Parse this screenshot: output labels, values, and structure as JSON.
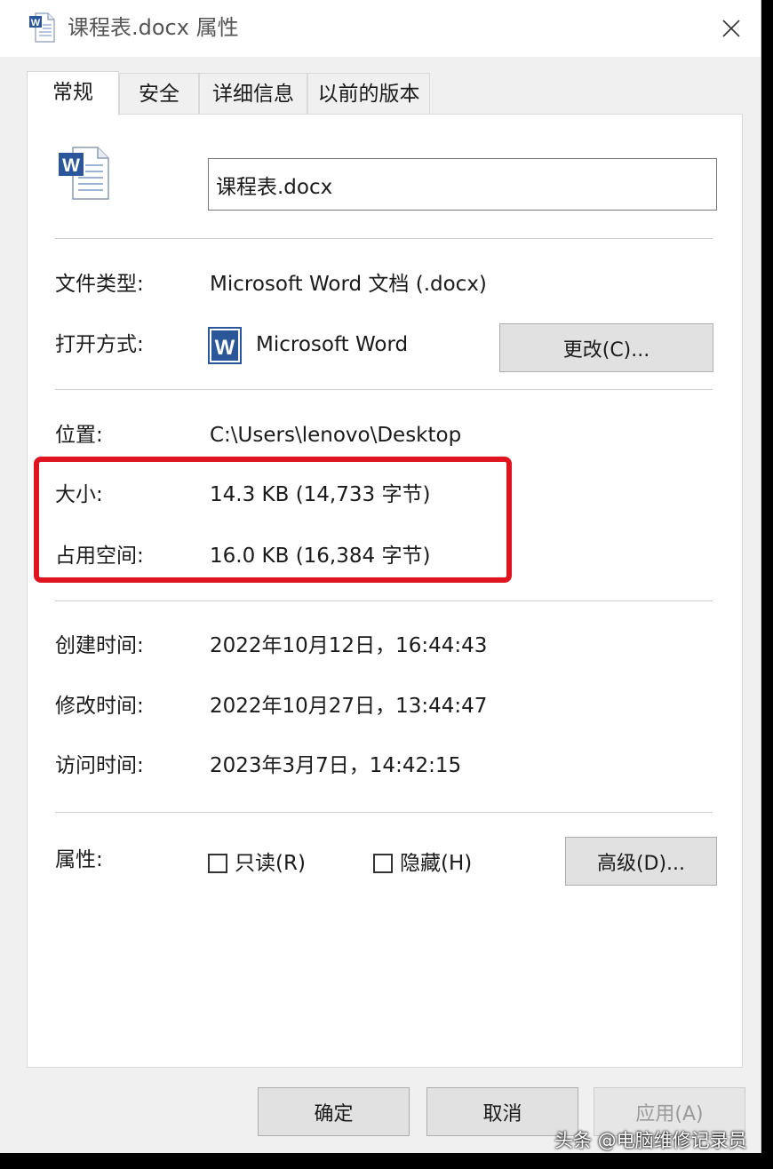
{
  "window": {
    "title": "课程表.docx 属性",
    "close_icon": "close-icon"
  },
  "tabs": [
    {
      "label": "常规",
      "active": true
    },
    {
      "label": "安全",
      "active": false
    },
    {
      "label": "详细信息",
      "active": false
    },
    {
      "label": "以前的版本",
      "active": false
    }
  ],
  "general": {
    "file_name": "课程表.docx",
    "file_type_label": "文件类型:",
    "file_type_value": "Microsoft Word 文档 (.docx)",
    "opens_with_label": "打开方式:",
    "opens_with_value": "Microsoft Word",
    "change_button": "更改(C)...",
    "location_label": "位置:",
    "location_value": "C:\\Users\\lenovo\\Desktop",
    "size_label": "大小:",
    "size_value": "14.3 KB (14,733 字节)",
    "size_on_disk_label": "占用空间:",
    "size_on_disk_value": "16.0 KB (16,384 字节)",
    "created_label": "创建时间:",
    "created_value": "2022年10月12日，16:44:43",
    "modified_label": "修改时间:",
    "modified_value": "2022年10月27日，13:44:47",
    "accessed_label": "访问时间:",
    "accessed_value": "2023年3月7日，14:42:15",
    "attributes_label": "属性:",
    "readonly_label": "只读(R)",
    "readonly_checked": false,
    "hidden_label": "隐藏(H)",
    "hidden_checked": false,
    "advanced_button": "高级(D)..."
  },
  "footer": {
    "ok_button": "确定",
    "cancel_button": "取消",
    "apply_button": "应用(A)"
  },
  "watermark": "头条 @电脑维修记录员",
  "colors": {
    "highlight": "#e0141e",
    "word_blue": "#2b579a"
  }
}
